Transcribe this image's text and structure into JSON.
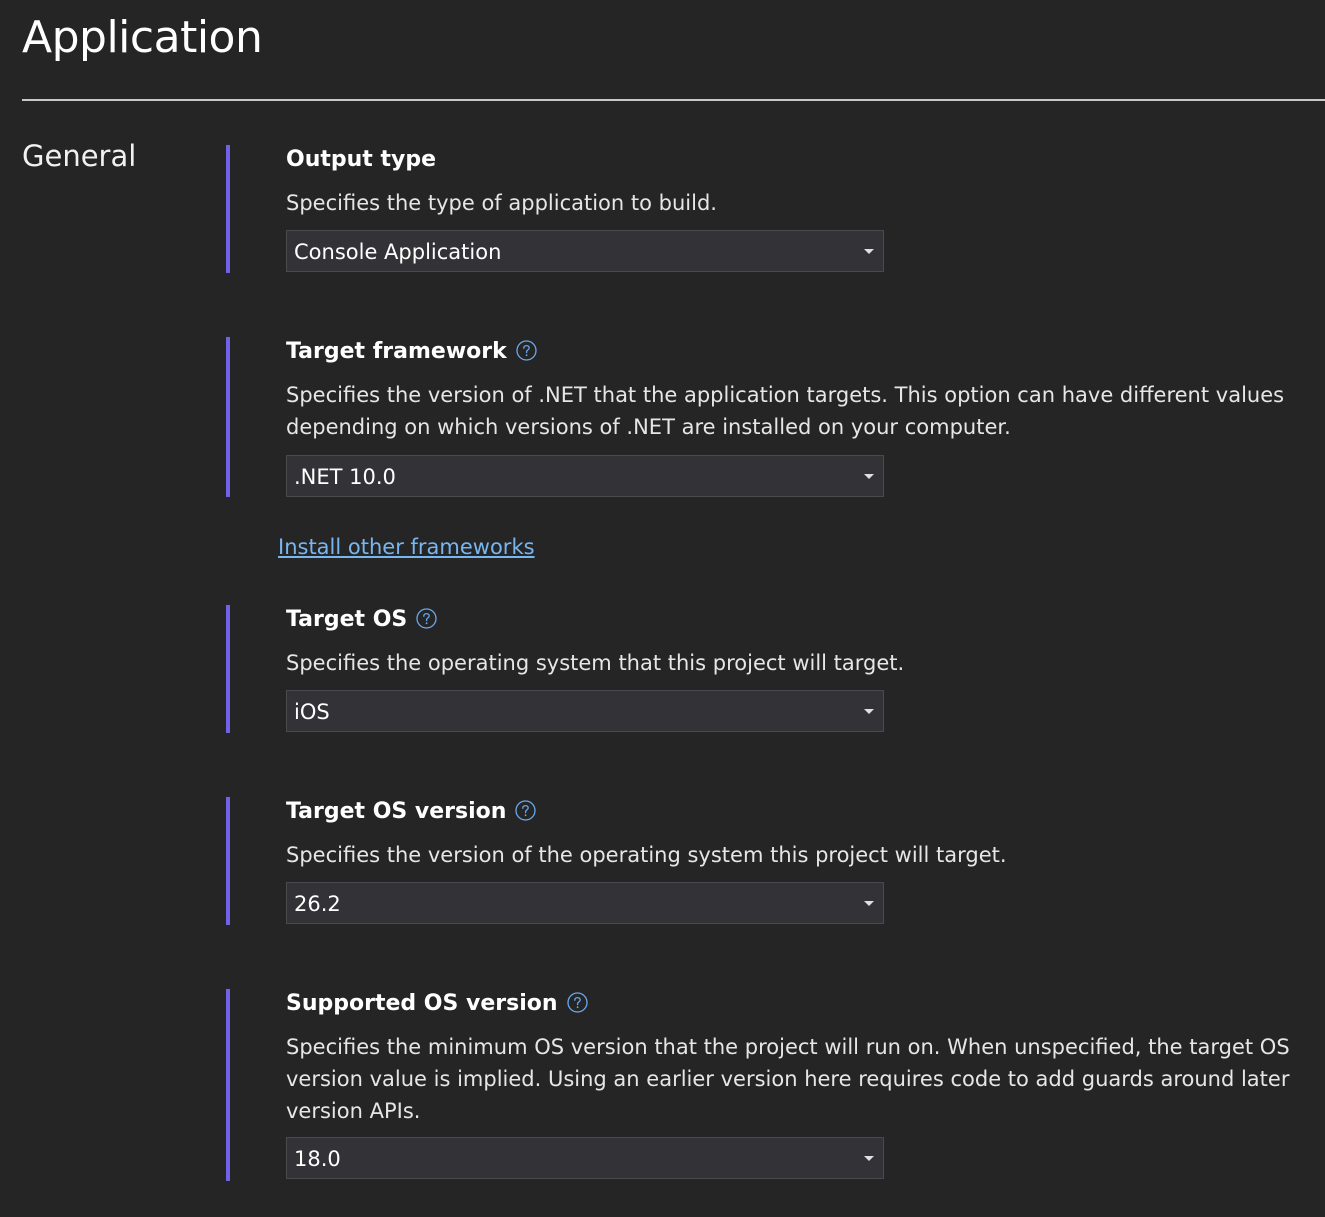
{
  "page": {
    "title": "Application"
  },
  "section": {
    "heading": "General"
  },
  "settings": {
    "output_type": {
      "title": "Output type",
      "description": "Specifies the type of application to build.",
      "value": "Console Application"
    },
    "target_framework": {
      "title": "Target framework",
      "description": "Specifies the version of .NET that the application targets. This option can have different values depending on which versions of .NET are installed on your computer.",
      "value": ".NET 10.0",
      "link": "Install other frameworks"
    },
    "target_os": {
      "title": "Target OS",
      "description": "Specifies the operating system that this project will target.",
      "value": "iOS"
    },
    "target_os_version": {
      "title": "Target OS version",
      "description": "Specifies the version of the operating system this project will target.",
      "value": "26.2"
    },
    "supported_os_version": {
      "title": "Supported OS version",
      "description": "Specifies the minimum OS version that the project will run on. When unspecified, the target OS version value is implied. Using an earlier version here requires code to add guards around later version APIs.",
      "value": "18.0"
    }
  },
  "icons": {
    "help": "help-circle-icon",
    "dropdown": "chevron-down-icon"
  },
  "colors": {
    "background": "#252526",
    "accent_bar": "#7160e8",
    "link": "#78b6f0",
    "help_icon": "#6aa8ec",
    "dropdown_bg": "#333337"
  }
}
